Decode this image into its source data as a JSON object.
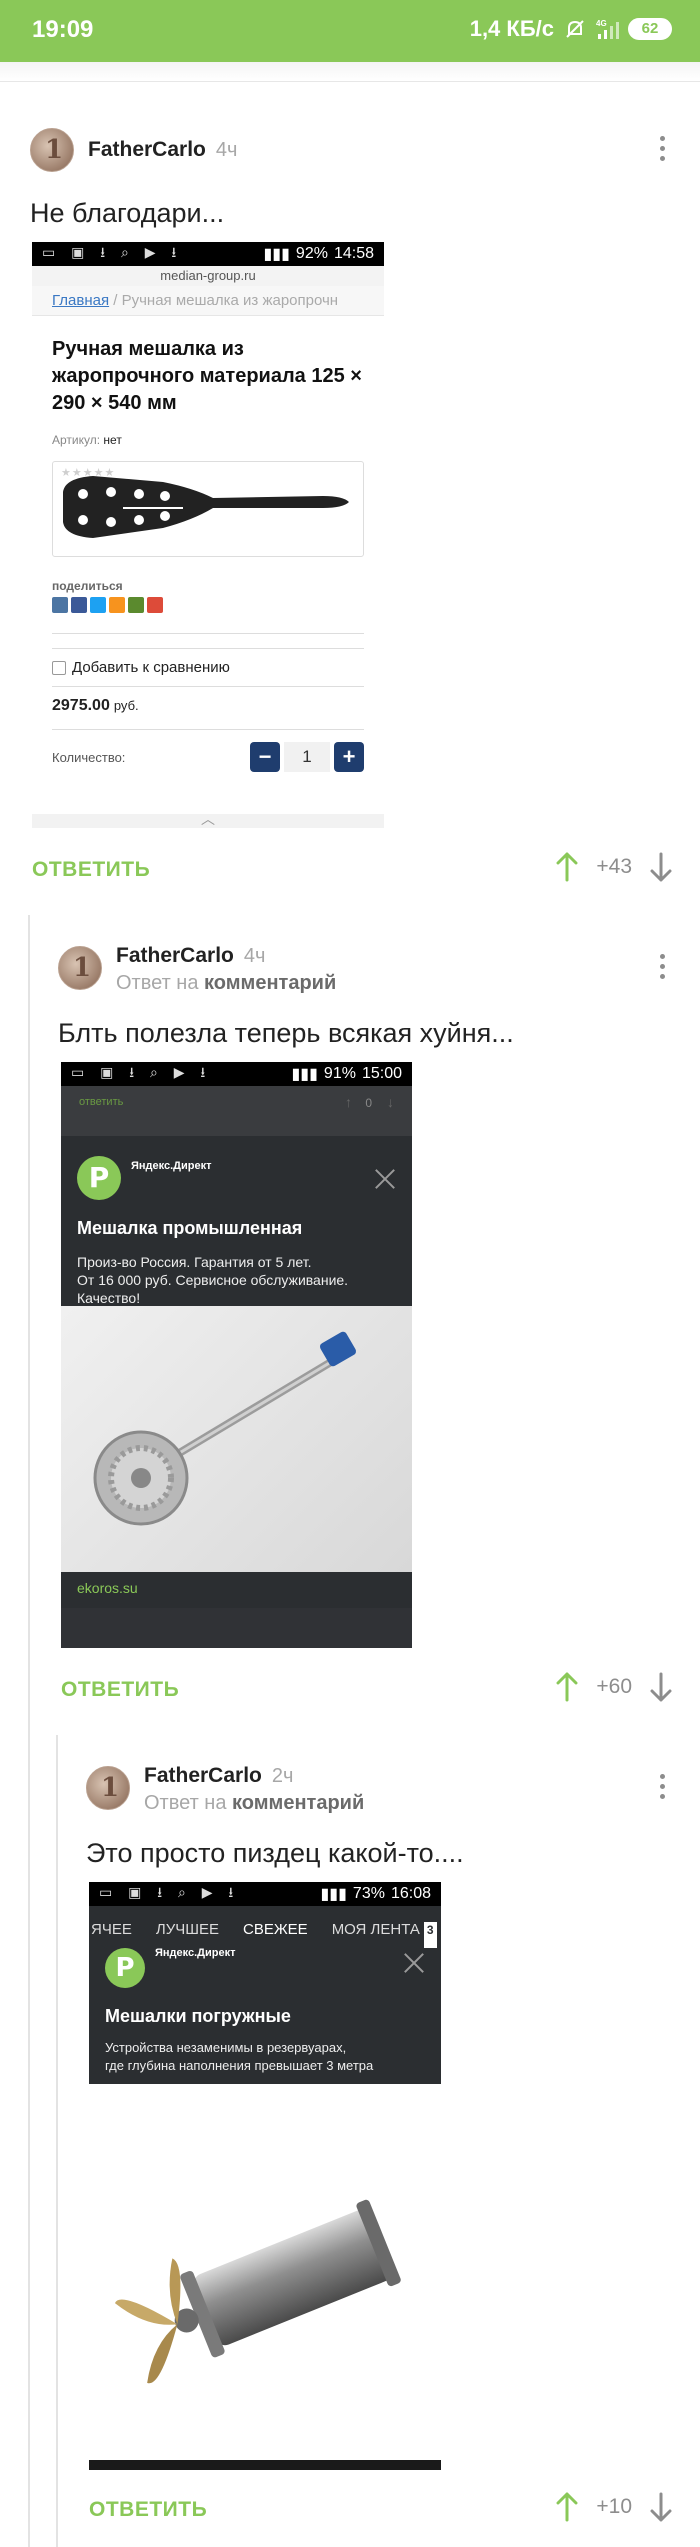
{
  "status_bar": {
    "time": "19:09",
    "net_speed": "1,4 КБ/с",
    "network": "4G",
    "battery": "62"
  },
  "comments": [
    {
      "author": "FatherCarlo",
      "age": "4ч",
      "reply_to_prefix": "",
      "reply_to_target": "",
      "text": "Не благодари...",
      "reply_label": "ОТВЕТИТЬ",
      "score": "+43",
      "shot": {
        "status_time": "14:58",
        "status_battery": "92%",
        "url": "median-group.ru",
        "breadcrumb_home": "Главная",
        "breadcrumb_rest": " / Ручная мешалка из жаропрочн",
        "product_title": "Ручная мешалка из жаропрочного материала 125 × 290 × 540 мм",
        "article_label": "Артикул:",
        "article_value": "нет",
        "share_label": "поделиться",
        "compare_label": "Добавить к сравнению",
        "price": "2975.00",
        "price_unit": "руб.",
        "qty_label": "Количество:",
        "qty_minus": "−",
        "qty_value": "1",
        "qty_plus": "+"
      }
    },
    {
      "author": "FatherCarlo",
      "age": "4ч",
      "reply_to_prefix": "Ответ на",
      "reply_to_target": "комментарий",
      "text": "Блть полезла теперь всякая хуйня...",
      "reply_label": "ОТВЕТИТЬ",
      "score": "+60",
      "shot": {
        "status_time": "15:00",
        "status_battery": "91%",
        "inner_reply": "ответить",
        "inner_score": "0",
        "ad_source": "Яндекс.Директ",
        "ad_logo": "P",
        "ad_title": "Мешалка промышленная",
        "ad_desc_1": "Произ-во Россия. Гарантия от 5 лет.",
        "ad_desc_2": "От 16 000 руб. Сервисное обслуживание.",
        "ad_desc_3": "Качество!",
        "ad_domain": "ekoros.su"
      }
    },
    {
      "author": "FatherCarlo",
      "age": "2ч",
      "reply_to_prefix": "Ответ на",
      "reply_to_target": "комментарий",
      "text": "Это просто пиздец какой-то....",
      "reply_label": "ОТВЕТИТЬ",
      "score": "+10",
      "shot": {
        "status_time": "16:08",
        "status_battery": "73%",
        "tabs": [
          "ЯЧЕЕ",
          "ЛУЧШЕЕ",
          "СВЕЖЕЕ",
          "МОЯ ЛЕНТА"
        ],
        "tab_badge": "3",
        "ad_source": "Яндекс.Директ",
        "ad_logo": "P",
        "ad_title": "Мешалки погружные",
        "ad_desc_1": "Устройства незаменимы в резервуарах,",
        "ad_desc_2": "где глубина наполнения превышает 3 метра"
      }
    }
  ],
  "colors": {
    "accent": "#8ac858",
    "muted": "#a7a7a7",
    "dark_ad": "#2b2e31"
  }
}
